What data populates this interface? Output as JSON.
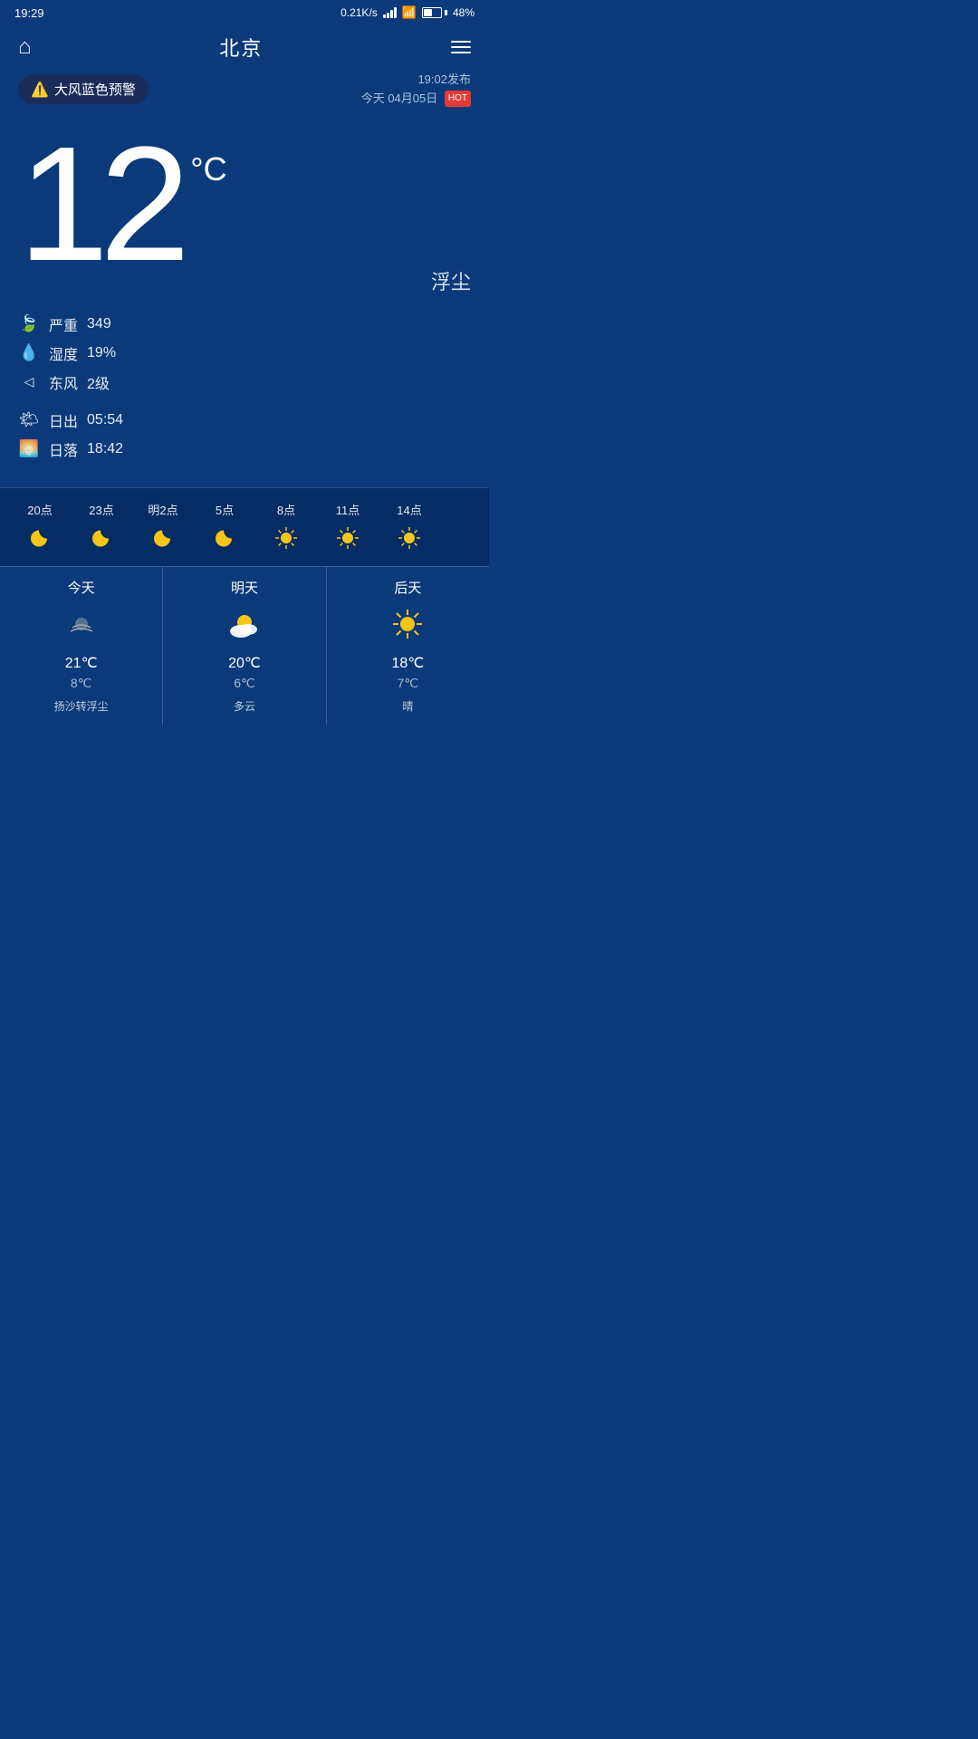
{
  "status": {
    "time": "19:29",
    "network_speed": "0.21K/s",
    "battery_pct": "48%"
  },
  "header": {
    "home_icon": "⌂",
    "city": "北京",
    "menu_icon": "≡"
  },
  "alert": {
    "icon": "⚠️",
    "text": "大风蓝色预警",
    "publish_time": "19:02发布",
    "date": "今天 04月05日",
    "hot_badge": "HOT"
  },
  "current": {
    "temperature": "12",
    "unit": "°C",
    "condition": "浮尘",
    "aqi_label": "严重",
    "aqi_value": "349",
    "humidity_label": "湿度",
    "humidity_value": "19%",
    "wind_label": "东风",
    "wind_level": "2级",
    "sunrise_label": "日出",
    "sunrise_time": "05:54",
    "sunset_label": "日落",
    "sunset_time": "18:42"
  },
  "hourly": [
    {
      "time": "20点",
      "icon": "moon",
      "type": "night"
    },
    {
      "time": "23点",
      "icon": "moon",
      "type": "night"
    },
    {
      "time": "明2点",
      "icon": "moon",
      "type": "night"
    },
    {
      "time": "5点",
      "icon": "moon",
      "type": "night"
    },
    {
      "time": "8点",
      "icon": "sun",
      "type": "day"
    },
    {
      "time": "11点",
      "icon": "sun",
      "type": "day"
    },
    {
      "time": "14点",
      "icon": "sun",
      "type": "day"
    }
  ],
  "daily": [
    {
      "day": "今天",
      "icon": "dusty",
      "hi": "21℃",
      "lo": "8℃",
      "desc": "扬沙转浮尘"
    },
    {
      "day": "明天",
      "icon": "partly-cloudy",
      "hi": "20℃",
      "lo": "6℃",
      "desc": "多云"
    },
    {
      "day": "后天",
      "icon": "sunny",
      "hi": "18℃",
      "lo": "7℃",
      "desc": "晴"
    }
  ]
}
